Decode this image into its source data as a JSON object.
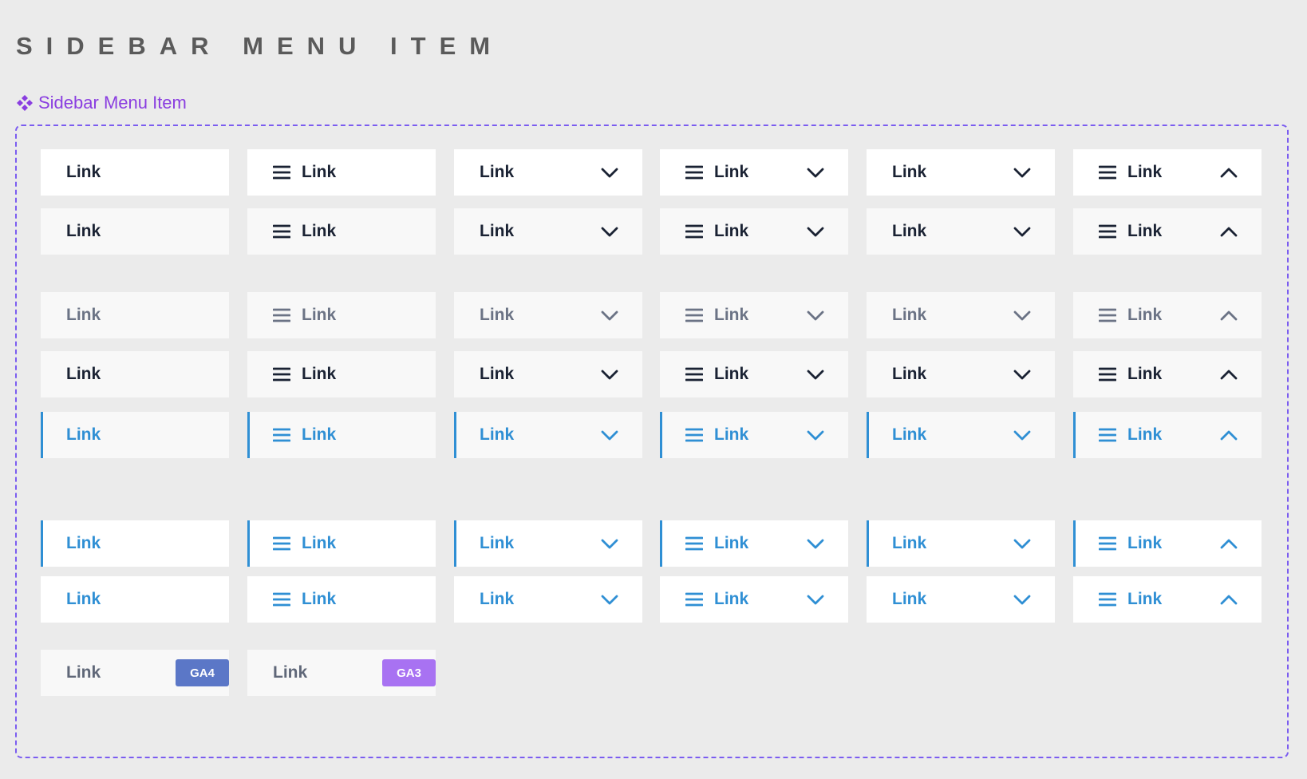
{
  "page_title": "SIDEBAR MENU ITEM",
  "component_label": "Sidebar Menu Item",
  "colors": {
    "background": "#ebebeb",
    "accent_purple": "#8a3ee0",
    "frame_dashed": "#7b5cf0",
    "text_dark": "#1a2233",
    "text_muted": "#6b7385",
    "active_blue": "#2f8fd4",
    "badge_ga4": "#5b77c7",
    "badge_ga3": "#a872f2"
  },
  "variants_per_row": [
    {
      "icon": "none",
      "label": "Link",
      "chevron": "none"
    },
    {
      "icon": "menu-icon",
      "label": "Link",
      "chevron": "none"
    },
    {
      "icon": "none",
      "label": "Link",
      "chevron": "chevron-down-icon"
    },
    {
      "icon": "menu-icon",
      "label": "Link",
      "chevron": "chevron-down-icon"
    },
    {
      "icon": "none",
      "label": "Link",
      "chevron": "chevron-down-icon"
    },
    {
      "icon": "menu-icon",
      "label": "Link",
      "chevron": "chevron-up-icon"
    }
  ],
  "rows": [
    {
      "state": "default",
      "background": "#ffffff",
      "text_color": "#1a2233",
      "active_bar": false
    },
    {
      "state": "hover",
      "background": "#f8f8f8",
      "text_color": "#1a2233",
      "active_bar": false
    },
    {
      "state": "inactive",
      "background": "#f8f8f8",
      "text_color": "#6b7385",
      "active_bar": false
    },
    {
      "state": "hover-dark",
      "background": "#f8f8f8",
      "text_color": "#1a2233",
      "active_bar": false
    },
    {
      "state": "active-hover",
      "background": "#f8f8f8",
      "text_color": "#2f8fd4",
      "active_bar": true
    },
    {
      "state": "active",
      "background": "#ffffff",
      "text_color": "#2f8fd4",
      "active_bar": true
    },
    {
      "state": "selected",
      "background": "#ffffff",
      "text_color": "#2f8fd4",
      "active_bar": false
    }
  ],
  "badge_items": [
    {
      "label": "Link",
      "badge": "GA4",
      "badge_color": "#5b77c7"
    },
    {
      "label": "Link",
      "badge": "GA3",
      "badge_color": "#a872f2"
    }
  ]
}
